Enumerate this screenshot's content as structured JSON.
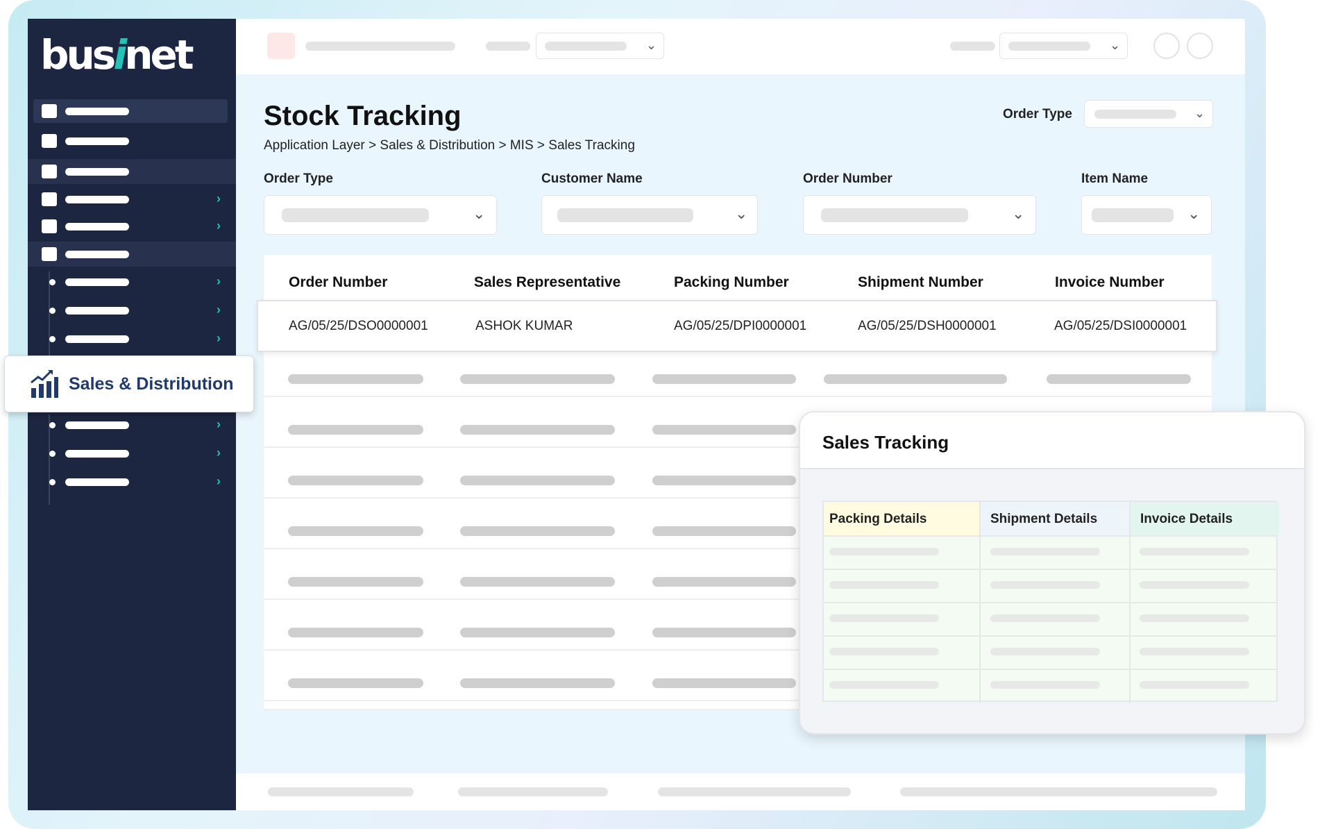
{
  "app": {
    "logo_text_a": "bus",
    "logo_text_i": "i",
    "logo_text_b": "net"
  },
  "sidebar": {
    "popup_label": "Sales & Distribution",
    "popup_icon": "bar-chart-icon"
  },
  "page": {
    "title": "Stock Tracking",
    "breadcrumb": "Application Layer > Sales & Distribution > MIS > Sales Tracking",
    "header_filter_label": "Order Type"
  },
  "filters": [
    {
      "label": "Order Type"
    },
    {
      "label": "Customer Name"
    },
    {
      "label": "Order Number"
    },
    {
      "label": "Item Name"
    }
  ],
  "table": {
    "columns": [
      "Order Number",
      "Sales Representative",
      "Packing Number",
      "Shipment Number",
      "Invoice Number"
    ],
    "rows": [
      [
        "AG/05/25/DSO0000001",
        "ASHOK KUMAR",
        "AG/05/25/DPI0000001",
        "AG/05/25/DSH0000001",
        "AG/05/25/DSI0000001"
      ]
    ]
  },
  "modal": {
    "title": "Sales Tracking",
    "columns": [
      "Packing Details",
      "Shipment Details",
      "Invoice Details"
    ],
    "colors": {
      "packing": "#fefbe0",
      "shipment": "#edf5fb",
      "invoice": "#e3f5ef"
    }
  }
}
